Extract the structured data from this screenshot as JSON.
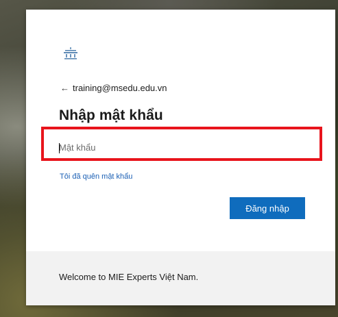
{
  "signin": {
    "logo_icon": "school-logo-icon",
    "back_icon": "back-arrow-icon",
    "account_email": "training@msedu.edu.vn",
    "title": "Nhập mật khẩu",
    "password_placeholder": "Mật khẩu",
    "password_value": "",
    "forgot_password_link": "Tôi đã quên mật khẩu",
    "submit_button": "Đăng nhập",
    "accent_color": "#0f6cbd",
    "highlight_color": "#e8141c"
  },
  "footer": {
    "message": "Welcome to MIE Experts Việt Nam."
  }
}
